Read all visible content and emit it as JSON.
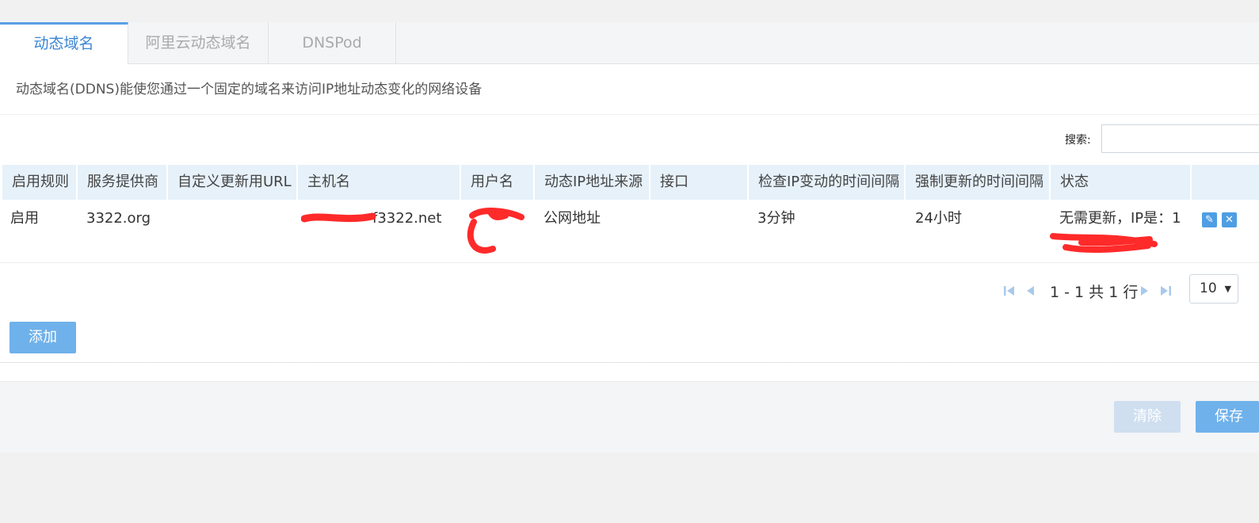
{
  "tabs": [
    {
      "label": "动态域名",
      "active": true
    },
    {
      "label": "阿里云动态域名",
      "active": false
    },
    {
      "label": "DNSPod",
      "active": false
    }
  ],
  "description": "动态域名(DDNS)能使您通过一个固定的域名来访问IP地址动态变化的网络设备",
  "search": {
    "label": "搜索:",
    "value": ""
  },
  "table": {
    "headers": [
      "启用规则",
      "服务提供商",
      "自定义更新用URL",
      "主机名",
      "用户名",
      "动态IP地址来源",
      "接口",
      "检查IP变动的时间间隔",
      "强制更新的时间间隔",
      "状态"
    ],
    "rows": [
      {
        "enabled": "启用",
        "provider": "3322.org",
        "custom_url": "",
        "hostname": "f3322.net",
        "username": "",
        "ip_source": "公网地址",
        "interface": "",
        "check_interval": "3分钟",
        "force_interval": "24小时",
        "status": "无需更新，IP是：1"
      }
    ]
  },
  "pagination": {
    "summary": "1 - 1 共 1 行",
    "page_size": "10"
  },
  "buttons": {
    "add": "添加",
    "clear": "清除",
    "save": "保存"
  },
  "icons": {
    "edit": "pencil-icon",
    "delete": "close-icon",
    "first": "first-page-icon",
    "prev": "prev-page-icon",
    "next": "next-page-icon",
    "last": "last-page-icon"
  },
  "colors": {
    "accent": "#3b86d4",
    "button": "#6fb1ea",
    "header_bg": "#e6f1fa",
    "redaction": "#ff2a2a"
  }
}
